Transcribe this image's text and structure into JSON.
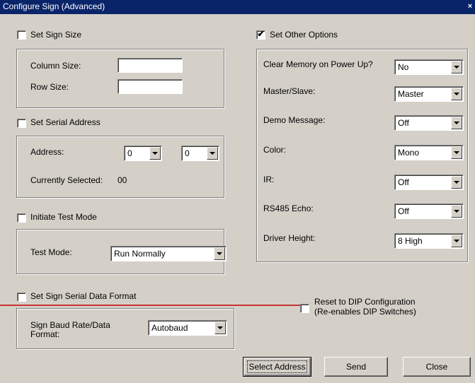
{
  "window": {
    "title": "Configure Sign (Advanced)",
    "close_glyph": "×"
  },
  "sign_size": {
    "checkbox_label": "Set Sign Size",
    "checked": false,
    "column_label": "Column Size:",
    "column_value": "",
    "row_label": "Row Size:",
    "row_value": ""
  },
  "serial_address": {
    "checkbox_label": "Set Serial Address",
    "checked": false,
    "address_label": "Address:",
    "address_high": "0",
    "address_low": "0",
    "currently_selected_label": "Currently Selected:",
    "currently_selected_value": "00"
  },
  "test_mode": {
    "checkbox_label": "Initiate Test Mode",
    "checked": false,
    "mode_label": "Test Mode:",
    "mode_value": "Run Normally"
  },
  "serial_format": {
    "checkbox_label": "Set Sign Serial Data Format",
    "checked": false,
    "baud_label_line1": "Sign Baud Rate/Data",
    "baud_label_line2": "Format:",
    "baud_value": "Autobaud"
  },
  "other_options": {
    "checkbox_label": "Set Other Options",
    "checked": true,
    "check_glyph": "✔",
    "rows": [
      {
        "label": "Clear Memory on Power Up?",
        "value": "No"
      },
      {
        "label": "Master/Slave:",
        "value": "Master"
      },
      {
        "label": "Demo Message:",
        "value": "Off"
      },
      {
        "label": "Color:",
        "value": "Mono"
      },
      {
        "label": "IR:",
        "value": "Off"
      },
      {
        "label": "RS485 Echo:",
        "value": "Off"
      },
      {
        "label": "Driver Height:",
        "value": "8 High"
      }
    ]
  },
  "reset_dip": {
    "checked": false,
    "label_line1": "Reset to DIP Configuration",
    "label_line2": "(Re-enables DIP Switches)"
  },
  "buttons": {
    "select_address": "Select Address",
    "send": "Send",
    "close": "Close"
  },
  "colors": {
    "titlebar": "#0a246a",
    "dialog_face": "#d4d0c8",
    "annotation_line": "#c00000"
  }
}
